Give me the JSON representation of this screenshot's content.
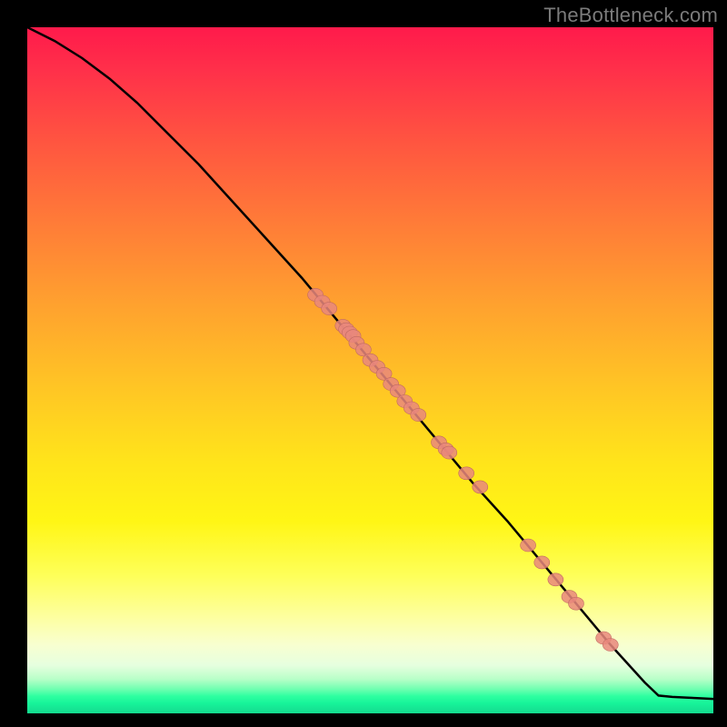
{
  "attribution": "TheBottleneck.com",
  "colors": {
    "background": "#000000",
    "curve": "#000000",
    "marker_fill": "#e9877c",
    "marker_stroke": "#c06a62"
  },
  "chart_data": {
    "type": "line",
    "title": "",
    "xlabel": "",
    "ylabel": "",
    "xlim": [
      0,
      100
    ],
    "ylim": [
      0,
      100
    ],
    "legend": false,
    "curve": [
      {
        "x": 0,
        "y": 100
      },
      {
        "x": 4,
        "y": 98
      },
      {
        "x": 8,
        "y": 95.5
      },
      {
        "x": 12,
        "y": 92.5
      },
      {
        "x": 16,
        "y": 89
      },
      {
        "x": 20,
        "y": 85
      },
      {
        "x": 25,
        "y": 80
      },
      {
        "x": 30,
        "y": 74.5
      },
      {
        "x": 35,
        "y": 69
      },
      {
        "x": 40,
        "y": 63.5
      },
      {
        "x": 45,
        "y": 57.5
      },
      {
        "x": 50,
        "y": 51.5
      },
      {
        "x": 55,
        "y": 45.5
      },
      {
        "x": 60,
        "y": 39.5
      },
      {
        "x": 65,
        "y": 33.5
      },
      {
        "x": 70,
        "y": 28
      },
      {
        "x": 75,
        "y": 22
      },
      {
        "x": 80,
        "y": 16
      },
      {
        "x": 85,
        "y": 10
      },
      {
        "x": 90,
        "y": 4.5
      },
      {
        "x": 92,
        "y": 2.6
      },
      {
        "x": 94,
        "y": 2.4
      },
      {
        "x": 96,
        "y": 2.3
      },
      {
        "x": 98,
        "y": 2.2
      },
      {
        "x": 100,
        "y": 2.1
      }
    ],
    "markers": [
      {
        "x": 42,
        "y": 61
      },
      {
        "x": 43,
        "y": 60
      },
      {
        "x": 44,
        "y": 59
      },
      {
        "x": 46,
        "y": 56.5
      },
      {
        "x": 46.5,
        "y": 56
      },
      {
        "x": 47,
        "y": 55.5
      },
      {
        "x": 47.5,
        "y": 55
      },
      {
        "x": 48,
        "y": 54
      },
      {
        "x": 49,
        "y": 53
      },
      {
        "x": 50,
        "y": 51.5
      },
      {
        "x": 51,
        "y": 50.5
      },
      {
        "x": 52,
        "y": 49.5
      },
      {
        "x": 53,
        "y": 48
      },
      {
        "x": 54,
        "y": 47
      },
      {
        "x": 55,
        "y": 45.5
      },
      {
        "x": 56,
        "y": 44.5
      },
      {
        "x": 57,
        "y": 43.5
      },
      {
        "x": 60,
        "y": 39.5
      },
      {
        "x": 61,
        "y": 38.5
      },
      {
        "x": 61.5,
        "y": 38
      },
      {
        "x": 64,
        "y": 35
      },
      {
        "x": 66,
        "y": 33
      },
      {
        "x": 73,
        "y": 24.5
      },
      {
        "x": 75,
        "y": 22
      },
      {
        "x": 77,
        "y": 19.5
      },
      {
        "x": 79,
        "y": 17
      },
      {
        "x": 80,
        "y": 16
      },
      {
        "x": 84,
        "y": 11
      },
      {
        "x": 85,
        "y": 10
      }
    ]
  }
}
